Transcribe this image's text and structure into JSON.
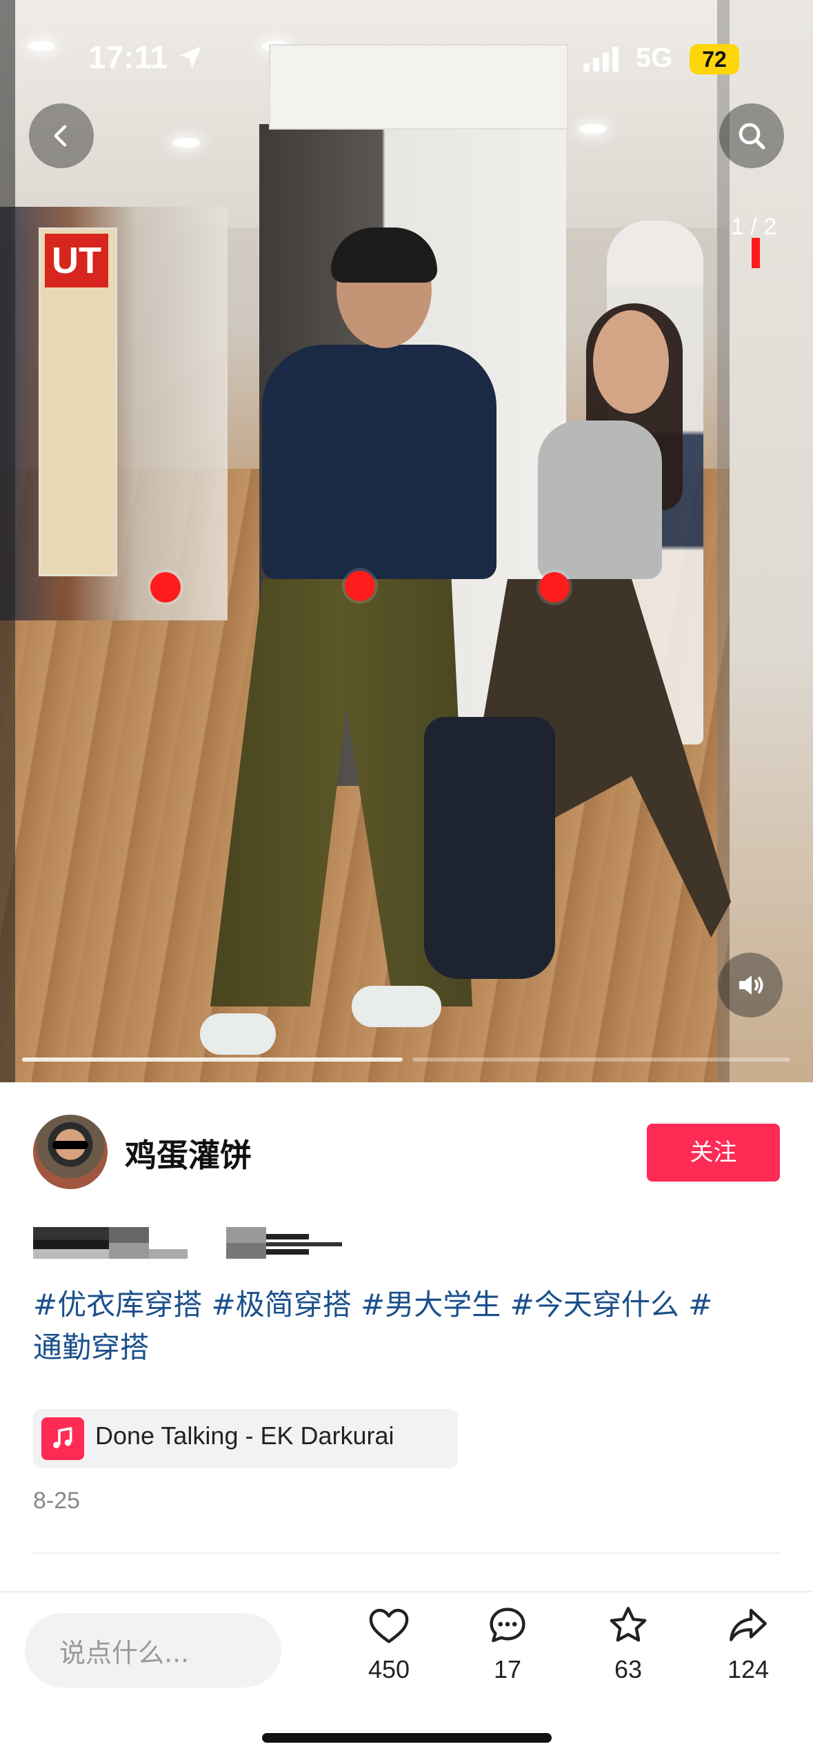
{
  "status_bar": {
    "time": "17:11",
    "network": "5G",
    "battery": "72"
  },
  "gallery": {
    "counter": "1 / 2",
    "current": 1,
    "total": 2
  },
  "post": {
    "author": "鸡蛋灌饼",
    "follow_label": "关注",
    "hashtags_line1": "#优衣库穿搭 #极简穿搭 #男大学生 #今天穿什么 #",
    "hashtags_line2": "通勤穿搭",
    "music_title": "Done Talking - EK Darkurai",
    "date": "8-25"
  },
  "bottom_bar": {
    "comment_placeholder": "说点什么...",
    "likes": "450",
    "comments": "17",
    "favorites": "63",
    "shares": "124"
  },
  "icons": {
    "back": "chevron-left-icon",
    "search": "search-icon",
    "volume": "volume-icon",
    "music": "music-note-icon",
    "like": "heart-icon",
    "comment": "comment-icon",
    "favorite": "star-icon",
    "share": "share-icon"
  },
  "colors": {
    "accent": "#ff2b55",
    "hashtag": "#1a4f8b",
    "battery": "#ffd60a",
    "hotspot": "#ff1c1c"
  }
}
